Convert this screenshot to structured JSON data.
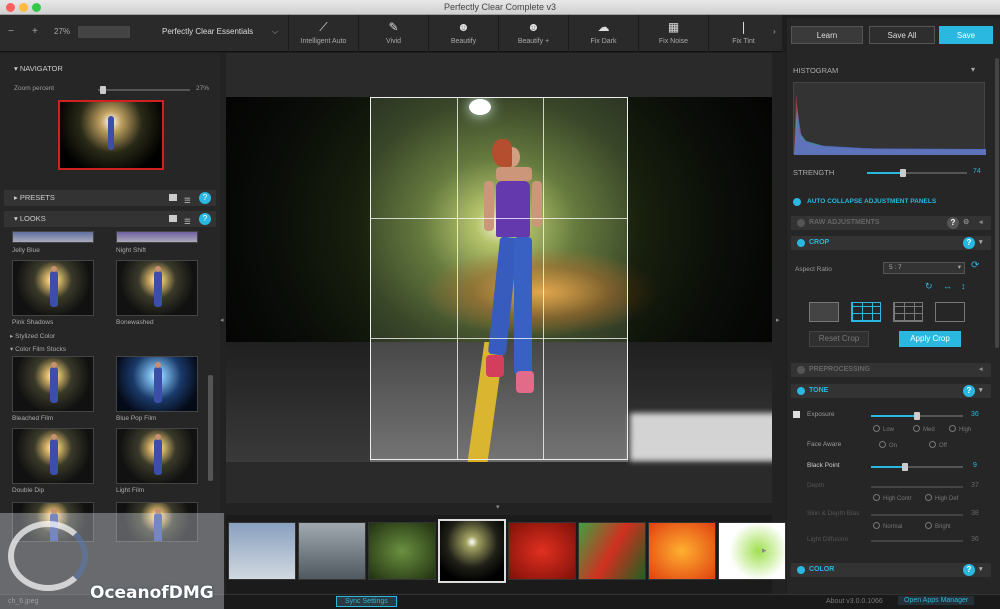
{
  "window": {
    "title": "Perfectly Clear Complete v3"
  },
  "toolbar": {
    "zoom": "27%",
    "preset_name": "Perfectly Clear Essentials",
    "tools": [
      {
        "label": "Intelligent Auto",
        "icon": "wand-icon"
      },
      {
        "label": "Vivid",
        "icon": "brush-icon"
      },
      {
        "label": "Beautify",
        "icon": "face-icon"
      },
      {
        "label": "Beautify +",
        "icon": "face-plus-icon"
      },
      {
        "label": "Fix Dark",
        "icon": "cloud-icon"
      },
      {
        "label": "Fix Noise",
        "icon": "noise-icon"
      },
      {
        "label": "Fix Tint",
        "icon": "thermometer-icon"
      }
    ]
  },
  "navigator": {
    "title": "NAVIGATOR",
    "zoom_label": "Zoom percent",
    "zoom_value": "27%"
  },
  "presets": {
    "title": "PRESETS"
  },
  "looks": {
    "title": "LOOKS",
    "items": [
      "Jelly Blue",
      "Night Shift",
      "Pink Shadows",
      "Bonewashed",
      "Bleached Film",
      "Blue Pop Film",
      "Double Dip",
      "Light Film"
    ],
    "group1": "Stylized Color",
    "group2": "Color Film Stocks"
  },
  "right": {
    "learn": "Learn",
    "save_all": "Save All",
    "save": "Save",
    "histogram": "HISTOGRAM",
    "strength": "STRENGTH",
    "strength_value": "74",
    "auto_collapse": "AUTO COLLAPSE ADJUSTMENT PANELS",
    "sections": {
      "raw": "RAW ADJUSTMENTS",
      "crop": "CROP",
      "pre": "PREPROCESSING",
      "tone": "TONE",
      "color": "COLOR"
    },
    "crop": {
      "aspect_label": "Aspect Ratio",
      "aspect_value": "5 : 7",
      "reset": "Reset Crop",
      "apply": "Apply Crop"
    },
    "tone": {
      "exposure": "Exposure",
      "exposure_value": "36",
      "exposure_levels": [
        "Low",
        "Med",
        "High"
      ],
      "face_aware": "Face Aware",
      "on": "On",
      "off": "Off",
      "black_point": "Black Point",
      "black_value": "9",
      "depth": "Depth",
      "depth_value": "37",
      "depth_opts": [
        "High Contr",
        "High Def"
      ],
      "skin": "Skin & Depth Bias",
      "skin_value": "38",
      "skin_opts": [
        "Normal",
        "Bright"
      ],
      "light_diff": "Light Diffusion",
      "light_value": "36"
    }
  },
  "status": {
    "file": "ch_6.jpeg",
    "sync": "Sync Settings",
    "about": "About v3.0.0.1066",
    "open_apps": "Open Apps Manager"
  },
  "watermark": "OceanofDMG"
}
